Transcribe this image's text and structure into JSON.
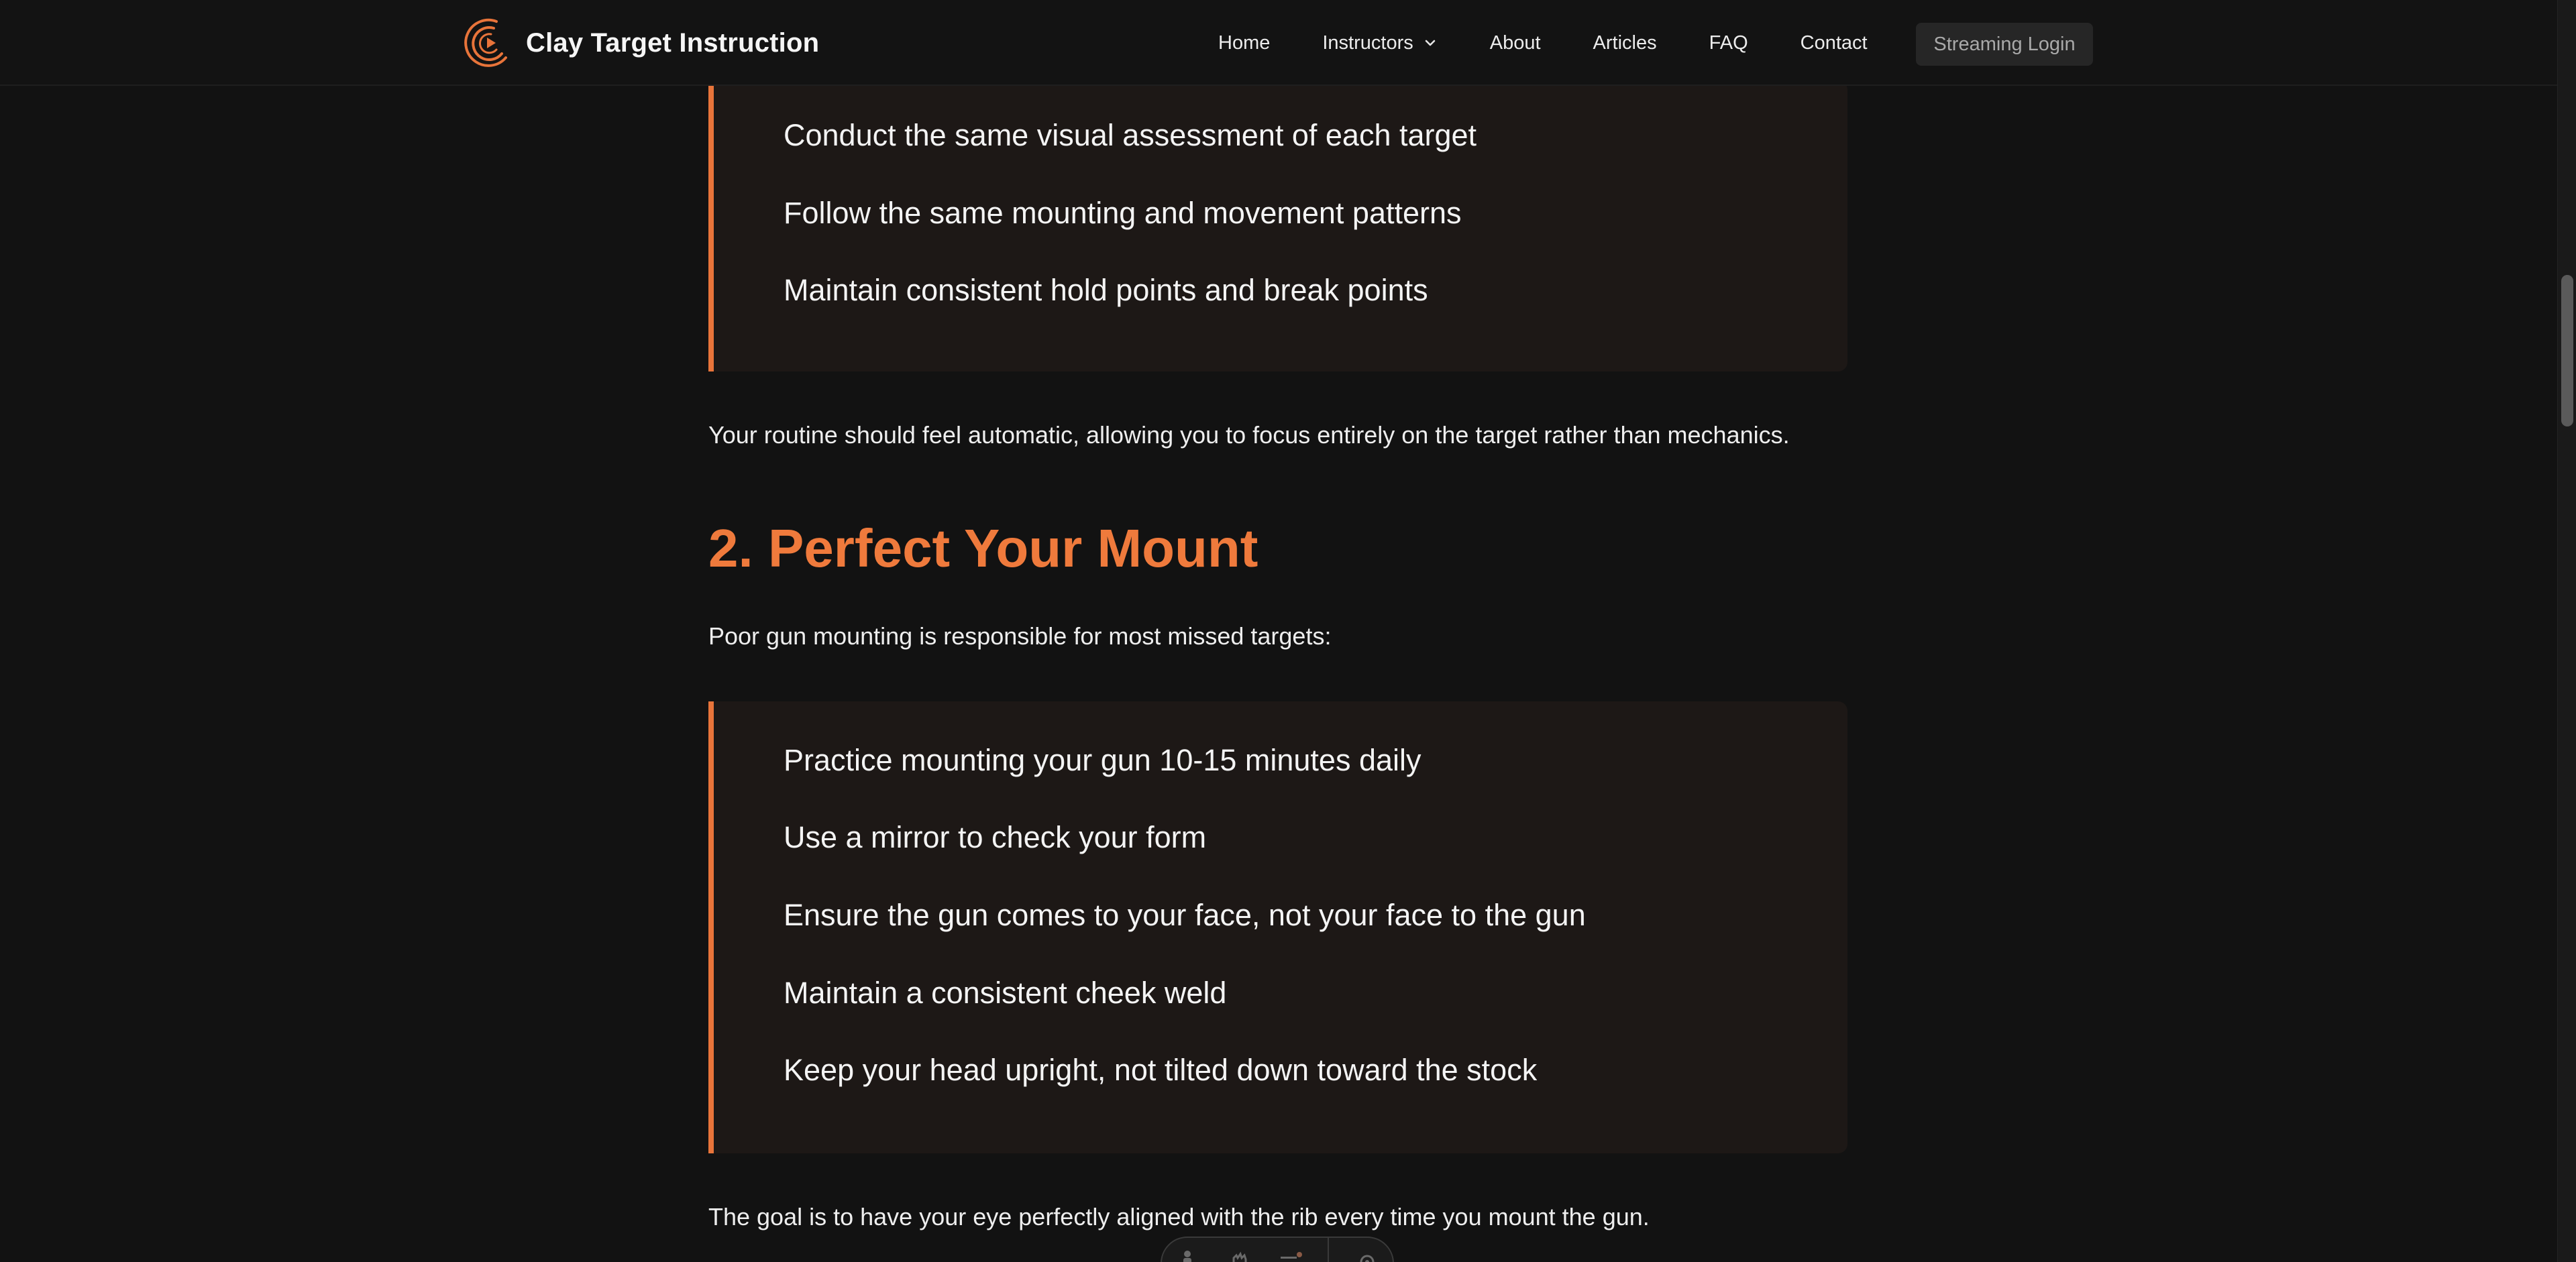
{
  "header": {
    "brand_name": "Clay Target Instruction",
    "nav": [
      {
        "label": "Home"
      },
      {
        "label": "Instructors",
        "has_dropdown": true
      },
      {
        "label": "About"
      },
      {
        "label": "Articles"
      },
      {
        "label": "FAQ"
      },
      {
        "label": "Contact"
      }
    ],
    "login_label": "Streaming Login"
  },
  "article": {
    "callout_1": [
      "Conduct the same visual assessment of each target",
      "Follow the same mounting and movement patterns",
      "Maintain consistent hold points and break points"
    ],
    "routine_text": "Your routine should feel automatic, allowing you to focus entirely on the target rather than mechanics.",
    "section_2_title": "2. Perfect Your Mount",
    "section_2_intro": "Poor gun mounting is responsible for most missed targets:",
    "callout_2": [
      "Practice mounting your gun 10-15 minutes daily",
      "Use a mirror to check your form",
      "Ensure the gun comes to your face, not your face to the gun",
      "Maintain a consistent cheek weld",
      "Keep your head upright, not tilted down toward the stock"
    ],
    "goal_text": "The goal is to have your eye perfectly aligned with the rib every time you mount the gun."
  },
  "colors": {
    "accent": "#ef7a3c",
    "background": "#121212",
    "callout_bg": "#1d1816",
    "login_bg": "#262626"
  },
  "icons": {
    "brand": "clay-target-logo-icon",
    "dropdown": "chevron-down-icon",
    "toolbar": [
      "accessibility-icon",
      "hand-icon",
      "list-icon",
      "gear-icon"
    ]
  }
}
